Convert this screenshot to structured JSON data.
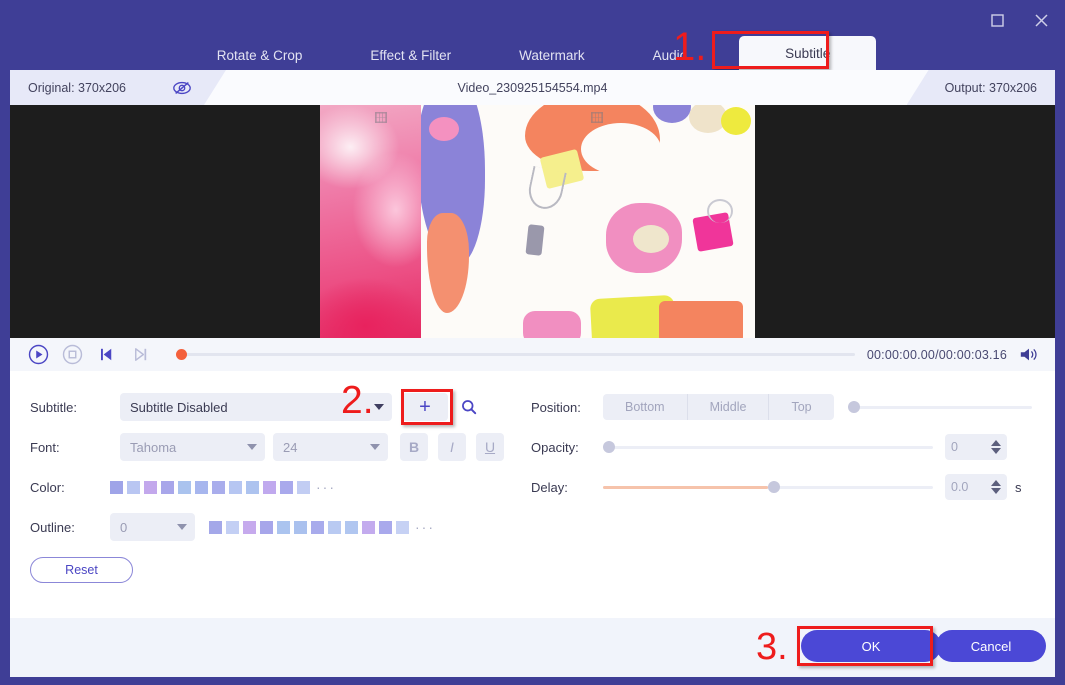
{
  "window": {
    "buttons": [
      {
        "name": "maximize",
        "icon": "maximize-icon"
      },
      {
        "name": "close",
        "icon": "close-icon"
      }
    ]
  },
  "tabs": [
    {
      "label": "Rotate & Crop",
      "active": false
    },
    {
      "label": "Effect & Filter",
      "active": false
    },
    {
      "label": "Watermark",
      "active": false
    },
    {
      "label": "Audio",
      "active": false
    },
    {
      "label": "Subtitle",
      "active": true
    }
  ],
  "annotations": [
    {
      "number": "1.",
      "target": "subtitle-tab"
    },
    {
      "number": "2.",
      "target": "add-subtitle-button"
    },
    {
      "number": "3.",
      "target": "ok-button"
    }
  ],
  "preview": {
    "original_label": "Original: 370x206",
    "output_label": "Output: 370x206",
    "file_name": "Video_230925154554.mp4",
    "eye_icon": "eye-off-icon"
  },
  "transport": {
    "play_icon": "play-icon",
    "stop_icon": "stop-icon",
    "prev_frame_icon": "previous-frame-icon",
    "next_frame_icon": "next-frame-icon",
    "volume_icon": "volume-icon",
    "timecode": "00:00:00.00/00:00:03.16",
    "seek_percent": 0
  },
  "settings": {
    "subtitle": {
      "label": "Subtitle:",
      "value": "Subtitle Disabled",
      "add_label": "+",
      "search_icon": "search-icon"
    },
    "font": {
      "label": "Font:",
      "family": "Tahoma",
      "size": "24",
      "bold_label": "B",
      "italic_label": "I",
      "underline_label": "U"
    },
    "color": {
      "label": "Color:",
      "more_label": "···",
      "swatches": [
        "#9fa4e8",
        "#b9c6f2",
        "#c3a8ec",
        "#a8a6ea",
        "#aac3ee",
        "#a7b6ee",
        "#a9adec",
        "#b6c6f2",
        "#adc3ef",
        "#c0a9ee",
        "#a9a9ec",
        "#c2cdf3"
      ]
    },
    "outline": {
      "label": "Outline:",
      "width": "0",
      "more_label": "···",
      "swatches": [
        "#a4a8e9",
        "#c3cff4",
        "#c6aaed",
        "#a7a6ea",
        "#abc4ef",
        "#aac1ee",
        "#a8abec",
        "#b9caf2",
        "#b0c6f0",
        "#c3abee",
        "#a9a9ec",
        "#c6d1f4"
      ]
    },
    "position": {
      "label": "Position:",
      "options": [
        "Bottom",
        "Middle",
        "Top"
      ],
      "slider_percent": 0
    },
    "opacity": {
      "label": "Opacity:",
      "value": "0",
      "slider_percent": 0
    },
    "delay": {
      "label": "Delay:",
      "value": "0.0",
      "unit": "s",
      "slider_percent": 50
    },
    "reset_label": "Reset"
  },
  "footer": {
    "ok_label": "OK",
    "cancel_label": "Cancel"
  },
  "colors": {
    "brand": "#3f3e96",
    "accent": "#4b48d6",
    "annotation": "#ee1c1c",
    "panel_bg": "#ffffff",
    "footer_bg": "#f1f4fb"
  }
}
